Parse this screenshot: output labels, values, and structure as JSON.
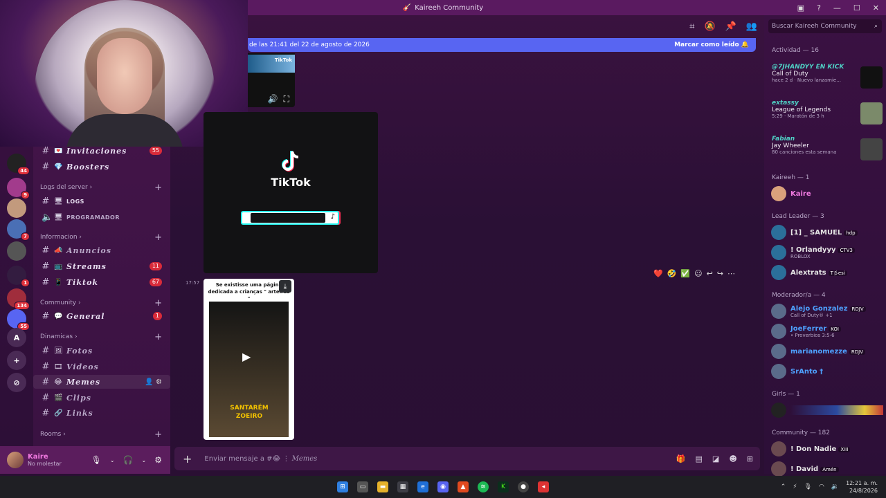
{
  "window": {
    "title": "Kaireeh Community"
  },
  "header": {
    "search_placeholder": "Buscar Kaireeh Community"
  },
  "new_messages": {
    "text": "de las 21:41 del 22 de agosto de 2026",
    "mark_read": "Marcar como leído"
  },
  "servers": [
    {
      "label": "",
      "badge": "44",
      "color": "#222"
    },
    {
      "label": "",
      "badge": "9",
      "color": "#a23b8c"
    },
    {
      "label": "",
      "badge": "",
      "color": "#c29a7d"
    },
    {
      "label": "",
      "badge": "7",
      "color": "#4a6fb5"
    },
    {
      "label": "",
      "badge": "",
      "color": "#555"
    },
    {
      "label": "",
      "badge": "1",
      "color": "#331c40"
    },
    {
      "label": "",
      "badge": "134",
      "color": "#a02d3c"
    },
    {
      "label": "",
      "badge": "55",
      "color": "#5865f2"
    },
    {
      "label": "A",
      "badge": "",
      "color": "#4a2a55"
    },
    {
      "label": "+",
      "badge": "",
      "color": "#4a2a55"
    },
    {
      "label": "⊘",
      "badge": "",
      "color": "#4a2a55"
    }
  ],
  "channels": {
    "invitaciones": {
      "name": "Invitaciones",
      "badge": "55"
    },
    "boosters": {
      "name": "Boosters"
    },
    "cat_logs": "Logs del server",
    "logs": {
      "name": "LOGS"
    },
    "programador": {
      "name": "PROGRAMADOR"
    },
    "cat_info": "Informacion",
    "anuncios": {
      "name": "Anuncios"
    },
    "streams": {
      "name": "Streams",
      "badge": "11"
    },
    "tiktok": {
      "name": "Tiktok",
      "badge": "67"
    },
    "cat_community": "Community",
    "general": {
      "name": "General",
      "badge": "1"
    },
    "cat_dinamicas": "Dinamicas",
    "fotos": {
      "name": "Fotos"
    },
    "videos": {
      "name": "Videos"
    },
    "memes": {
      "name": "Memes"
    },
    "clips": {
      "name": "Clips"
    },
    "links": {
      "name": "Links"
    },
    "cat_rooms": "Rooms"
  },
  "user": {
    "name": "Kaire",
    "status": "No molestar"
  },
  "messages": {
    "tiktok_brand": "TikTok",
    "tiktok_mini": "TikTok",
    "time": "17:57",
    "video_caption": "Se existisse uma página dedicada a crianças \" arteiras \"",
    "video_stamp": "SANTARÉM ZOEIRO"
  },
  "composer": {
    "placeholder_prefix": "Enviar mensaje a #",
    "channel": "Memes"
  },
  "members": {
    "activity_title": "Actividad — 16",
    "activity": [
      {
        "user": "@7JHANDYY EN KICK",
        "game": "Call of Duty",
        "meta": "hace 2 d · Nuevo lanzamie...",
        "thumb": "#111"
      },
      {
        "user": "extassy",
        "game": "League of Legends",
        "meta": "5:29 · Maratón de 3 h",
        "thumb": "#7b8a6a"
      },
      {
        "user": "Fabian",
        "game": "Jay Wheeler",
        "meta": "80 canciones esta semana",
        "thumb": "#444"
      }
    ],
    "kaireeh_title": "Kaireeh — 1",
    "kaireeh": [
      {
        "name": "Kaire",
        "sub": "",
        "color": "#f07ae0",
        "tag": ""
      }
    ],
    "lead_title": "Lead Leader — 3",
    "lead": [
      {
        "name": "[1] _ SAMUEL",
        "sub": "",
        "color": "#e5e5e5",
        "tag": "hdp"
      },
      {
        "name": "! Orlandyyy",
        "sub": "ROBLOX",
        "color": "#e5e5e5",
        "tag": "CTV3"
      },
      {
        "name": "Alextrats",
        "sub": "",
        "color": "#e5e5e5",
        "tag": "T彡esi"
      }
    ],
    "mod_title": "Moderador/a — 4",
    "mods": [
      {
        "name": "Alejo Gonzalez",
        "sub": "Call of Duty® +1",
        "color": "#4ea1ff",
        "tag": "RDJV"
      },
      {
        "name": "JoeFerrer",
        "sub": "• Proverbios 3:5-6",
        "color": "#4ea1ff",
        "tag": "KOI"
      },
      {
        "name": "marianomezze",
        "sub": "",
        "color": "#4ea1ff",
        "tag": "RDJV"
      },
      {
        "name": "SrAnto †",
        "sub": "",
        "color": "#4ea1ff",
        "tag": ""
      }
    ],
    "girls_title": "Girls — 1",
    "community_title": "Community — 182",
    "community": [
      {
        "name": "! Don Nadie",
        "sub": "",
        "color": "#e5e5e5",
        "tag": "XIII"
      },
      {
        "name": "! David",
        "sub": "",
        "color": "#e5e5e5",
        "tag": "Amén"
      }
    ]
  },
  "taskbar": {
    "time": "12:21 a. m.",
    "date": "24/8/2026"
  }
}
